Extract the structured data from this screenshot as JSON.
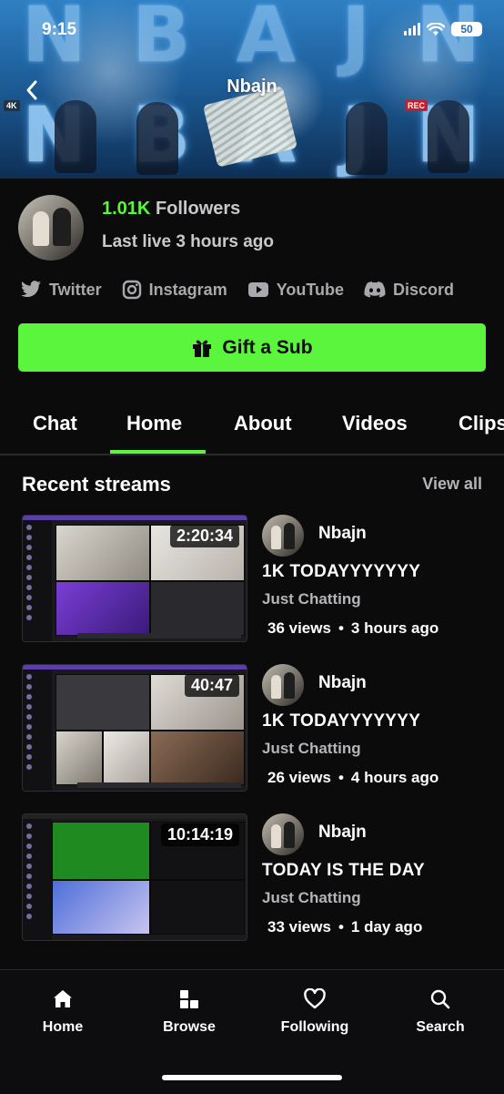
{
  "status_bar": {
    "time": "9:15",
    "battery": "50"
  },
  "header": {
    "title": "Nbajn"
  },
  "profile": {
    "followers_count": "1.01K",
    "followers_label": "Followers",
    "last_live": "Last live 3 hours ago"
  },
  "socials": [
    {
      "label": "Twitter",
      "icon": "twitter-icon"
    },
    {
      "label": "Instagram",
      "icon": "instagram-icon"
    },
    {
      "label": "YouTube",
      "icon": "youtube-icon"
    },
    {
      "label": "Discord",
      "icon": "discord-icon"
    }
  ],
  "gift_button": {
    "label": "Gift a Sub",
    "icon": "gift-icon"
  },
  "tabs": [
    {
      "label": "Chat"
    },
    {
      "label": "Home",
      "active": true
    },
    {
      "label": "About"
    },
    {
      "label": "Videos"
    },
    {
      "label": "Clips"
    }
  ],
  "recent_streams": {
    "title": "Recent streams",
    "view_all": "View all",
    "items": [
      {
        "duration": "2:20:34",
        "channel": "Nbajn",
        "title": "1K TODAYYYYYYY",
        "category": "Just Chatting",
        "views": "36 views",
        "ago": "3 hours ago"
      },
      {
        "duration": "40:47",
        "channel": "Nbajn",
        "title": "1K TODAYYYYYYY",
        "category": "Just Chatting",
        "views": "26 views",
        "ago": "4 hours ago"
      },
      {
        "duration": "10:14:19",
        "channel": "Nbajn",
        "title": "TODAY IS THE DAY",
        "category": "Just Chatting",
        "views": "33 views",
        "ago": "1 day ago"
      }
    ],
    "separator": "•"
  },
  "bottom_nav": [
    {
      "label": "Home",
      "icon": "home-icon"
    },
    {
      "label": "Browse",
      "icon": "browse-icon"
    },
    {
      "label": "Following",
      "icon": "heart-icon"
    },
    {
      "label": "Search",
      "icon": "search-icon"
    }
  ],
  "colors": {
    "accent": "#5cf53d",
    "background": "#0b0b0c",
    "muted_text": "#b5b5b9"
  }
}
